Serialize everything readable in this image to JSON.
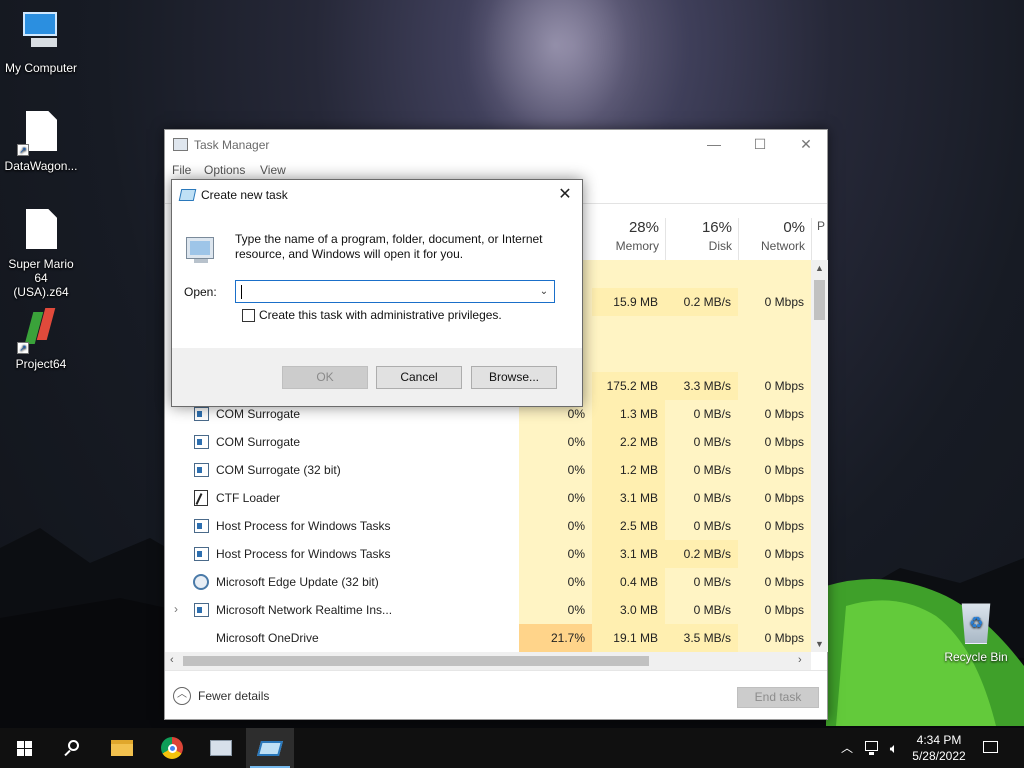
{
  "desktop": {
    "icons": [
      {
        "label": "My Computer"
      },
      {
        "label": "DataWagon..."
      },
      {
        "label": "Super Mario 64 (USA).z64"
      },
      {
        "label": "Project64"
      }
    ],
    "recycle_bin": "Recycle Bin"
  },
  "task_manager": {
    "title": "Task Manager",
    "menu": [
      "File",
      "Options",
      "View"
    ],
    "columns": [
      {
        "pct": "28%",
        "name": "Memory"
      },
      {
        "pct": "16%",
        "name": "Disk"
      },
      {
        "pct": "0%",
        "name": "Network"
      },
      {
        "pct": "",
        "name": "P"
      }
    ],
    "rows": [
      {
        "name": "",
        "cpu": "",
        "mem": "15.9 MB",
        "disk": "0.2 MB/s",
        "net": "0 Mbps"
      },
      {
        "name": "",
        "cpu": "",
        "mem": "175.2 MB",
        "disk": "3.3 MB/s",
        "net": "0 Mbps"
      },
      {
        "name": "COM Surrogate",
        "cpu": "0%",
        "mem": "1.3 MB",
        "disk": "0 MB/s",
        "net": "0 Mbps"
      },
      {
        "name": "COM Surrogate",
        "cpu": "0%",
        "mem": "2.2 MB",
        "disk": "0 MB/s",
        "net": "0 Mbps"
      },
      {
        "name": "COM Surrogate (32 bit)",
        "cpu": "0%",
        "mem": "1.2 MB",
        "disk": "0 MB/s",
        "net": "0 Mbps"
      },
      {
        "name": "CTF Loader",
        "cpu": "0%",
        "mem": "3.1 MB",
        "disk": "0 MB/s",
        "net": "0 Mbps"
      },
      {
        "name": "Host Process for Windows Tasks",
        "cpu": "0%",
        "mem": "2.5 MB",
        "disk": "0 MB/s",
        "net": "0 Mbps"
      },
      {
        "name": "Host Process for Windows Tasks",
        "cpu": "0%",
        "mem": "3.1 MB",
        "disk": "0.2 MB/s",
        "net": "0 Mbps"
      },
      {
        "name": "Microsoft Edge Update (32 bit)",
        "cpu": "0%",
        "mem": "0.4 MB",
        "disk": "0 MB/s",
        "net": "0 Mbps"
      },
      {
        "name": "Microsoft Network Realtime Ins...",
        "cpu": "0%",
        "mem": "3.0 MB",
        "disk": "0 MB/s",
        "net": "0 Mbps"
      },
      {
        "name": "Microsoft OneDrive",
        "cpu": "21.7%",
        "mem": "19.1 MB",
        "disk": "3.5 MB/s",
        "net": "0 Mbps"
      }
    ],
    "fewer_details": "Fewer details",
    "end_task": "End task"
  },
  "run_dialog": {
    "title": "Create new task",
    "close": "✕",
    "description": "Type the name of a program, folder, document, or Internet resource, and Windows will open it for you.",
    "open_label": "Open:",
    "open_value": "",
    "admin_checkbox": "Create this task with administrative privileges.",
    "admin_checked": false,
    "ok": "OK",
    "cancel": "Cancel",
    "browse": "Browse..."
  },
  "taskbar": {
    "icons": [
      "windows-start-icon",
      "search-icon",
      "file-explorer-icon",
      "chrome-icon",
      "task-manager-icon",
      "run-dialog-icon"
    ],
    "time": "4:34 PM",
    "date": "5/28/2022"
  }
}
